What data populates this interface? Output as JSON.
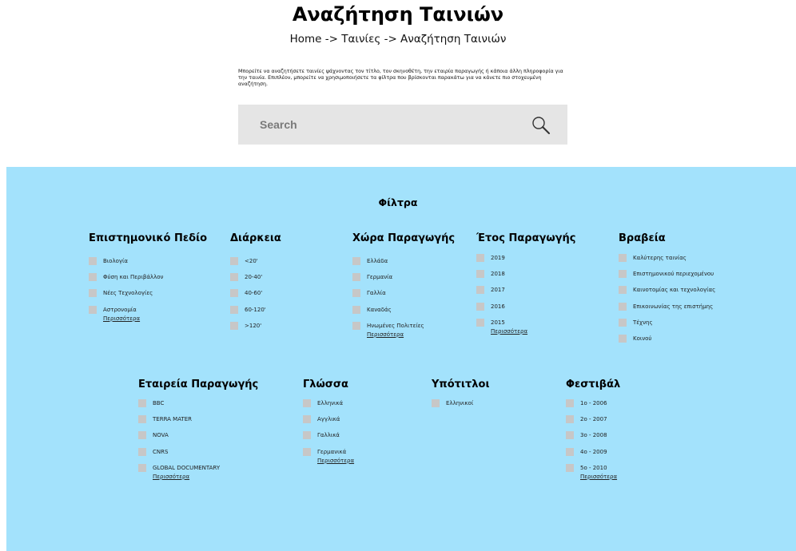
{
  "header": {
    "title": "Αναζήτηση Ταινιών",
    "breadcrumb": "Home -> Ταινίες -> Αναζήτηση Ταινιών"
  },
  "intro": "Μπορείτε να αναζητήσετε ταινίες ψάχνοντας τον τίτλο, τον σκηνοθέτη, την εταιρία παραγωγής ή κάποια άλλη πληροφορία για την ταινία. Επιπλέον, μπορείτε να χρησιμοποιήσετε τα φίλτρα που βρίσκονται παρακάτω για να κάνετε πιο στοχευμένη αναζήτηση.",
  "search": {
    "placeholder": "Search",
    "icon": "search-icon"
  },
  "filters": {
    "title": "Φίλτρα",
    "more_label": "Περισσότερα",
    "groups": [
      {
        "title": "Επιστημονικό Πεδίο",
        "items": [
          "Βιολογία",
          "Φύση και Περιβάλλον",
          "Νέες Τεχνολογίες",
          "Αστρονομία"
        ],
        "has_more": true
      },
      {
        "title": "Διάρκεια",
        "items": [
          "<20'",
          "20-40'",
          "40-60'",
          "60-120'",
          ">120'"
        ],
        "has_more": false
      },
      {
        "title": "Χώρα Παραγωγής",
        "items": [
          "Ελλάδα",
          "Γερμανία",
          "Γαλλία",
          "Καναδάς",
          "Ηνωμένες Πολιτείες"
        ],
        "has_more": true
      },
      {
        "title": "Έτος Παραγωγής",
        "items": [
          "2019",
          "2018",
          "2017",
          "2016",
          "2015"
        ],
        "has_more": true
      },
      {
        "title": "Βραβεία",
        "items": [
          "Καλύτερης ταινίας",
          "Επιστημονικού περιεχομένου",
          "Καινοτομίας και τεχνολογίας",
          "Επικοινωνίας της επιστήμης",
          "Τέχνης",
          "Κοινού"
        ],
        "has_more": false
      },
      {
        "title": "Εταιρεία Παραγωγής",
        "items": [
          "BBC",
          "TERRA MATER",
          "NOVA",
          "CNRS",
          "GLOBAL DOCUMENTARY"
        ],
        "has_more": true
      },
      {
        "title": "Γλώσσα",
        "items": [
          "Ελληνικά",
          "Αγγλικά",
          "Γαλλικά",
          "Γερμανικά"
        ],
        "has_more": true
      },
      {
        "title": "Υπότιτλοι",
        "items": [
          "Ελληνικοί"
        ],
        "has_more": false
      },
      {
        "title": "Φεστιβάλ",
        "items": [
          "1ο - 2006",
          "2ο - 2007",
          "3ο - 2008",
          "4ο - 2009",
          "5ο - 2010"
        ],
        "has_more": true
      }
    ]
  }
}
